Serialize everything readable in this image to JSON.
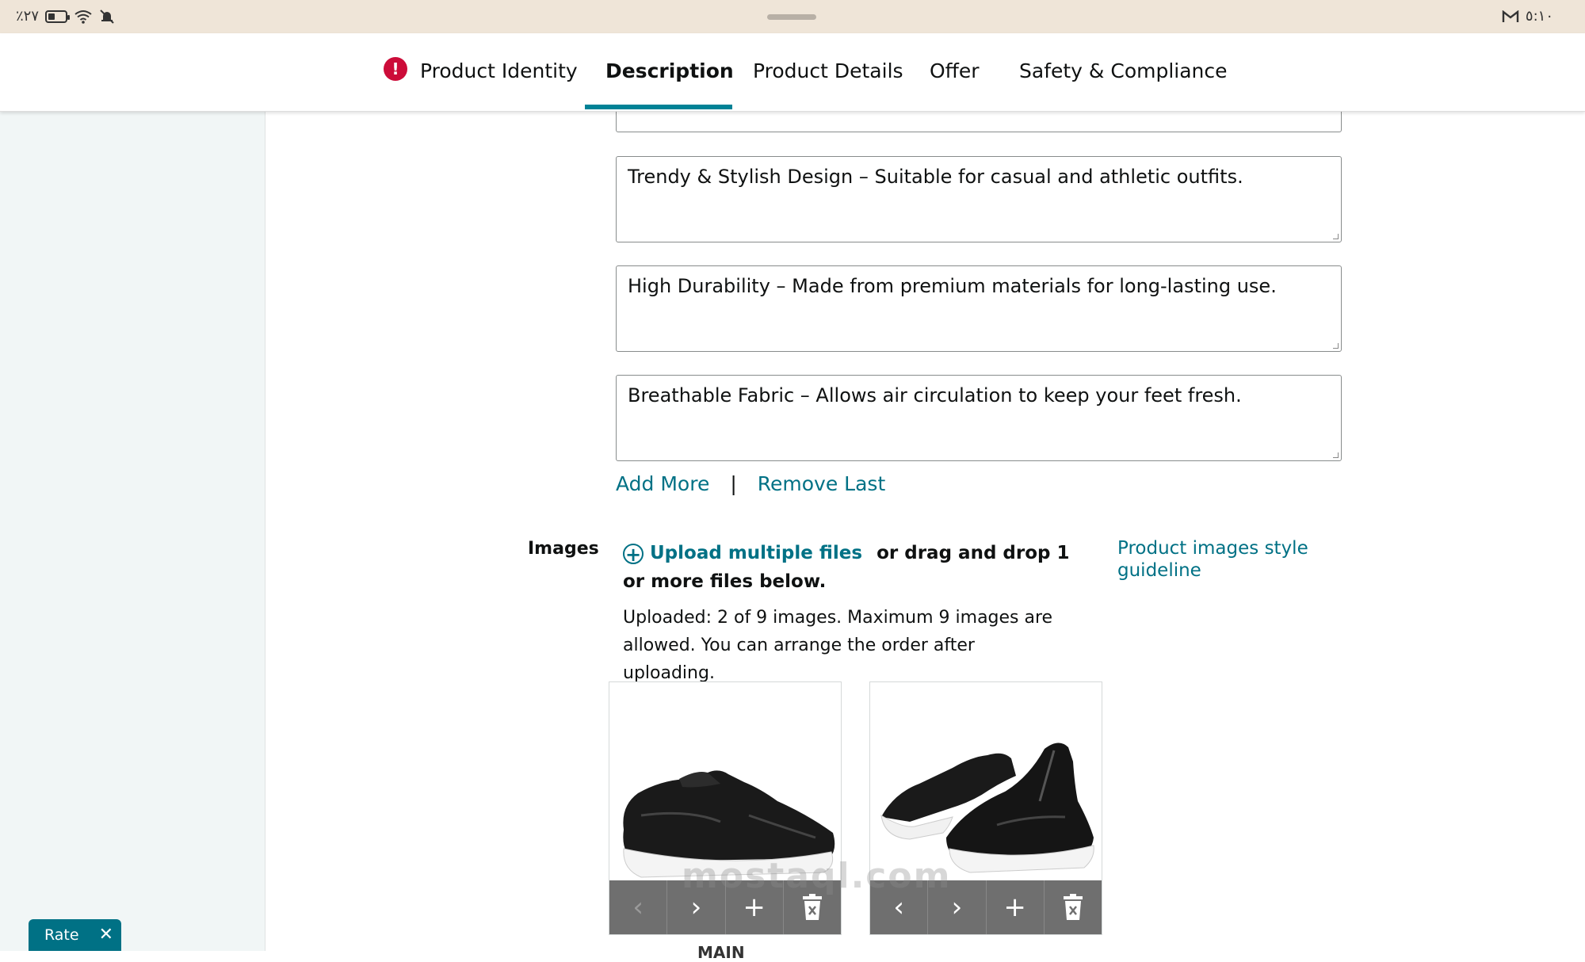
{
  "status_bar": {
    "battery_text": "٪٢٧",
    "time": "٥:١٠"
  },
  "tabs": [
    {
      "label": "Product Identity",
      "has_error": true,
      "error_symbol": "!"
    },
    {
      "label": "Description",
      "active": true
    },
    {
      "label": "Product Details"
    },
    {
      "label": "Offer"
    },
    {
      "label": "Safety & Compliance"
    }
  ],
  "bullets": [
    "",
    "Trendy & Stylish Design – Suitable for casual and athletic outfits.",
    "High Durability – Made from premium materials for long-lasting use.",
    "Breathable Fabric – Allows air circulation to keep your feet fresh."
  ],
  "bullet_actions": {
    "add_more": "Add More",
    "separator": "|",
    "remove_last": "Remove Last"
  },
  "images": {
    "label": "Images",
    "upload_link": "Upload multiple files",
    "upload_rest": "or drag and drop 1 or more files below.",
    "note": "Uploaded: 2 of 9 images. Maximum 9 images are allowed. You can arrange the order after uploading.",
    "guideline_link": "Product images style guideline",
    "main_label": "MAIN",
    "uploaded_count": 2,
    "max_count": 9
  },
  "image_toolbar_icons": [
    "chevron-left-icon",
    "chevron-right-icon",
    "plus-icon",
    "trash-icon"
  ],
  "watermark": "mostaql.com",
  "rate_widget": {
    "label": "Rate",
    "close": "✕"
  },
  "colors": {
    "accent": "#008296",
    "link": "#007185",
    "error": "#cc0c39",
    "sidebar": "#f1f6f6"
  }
}
